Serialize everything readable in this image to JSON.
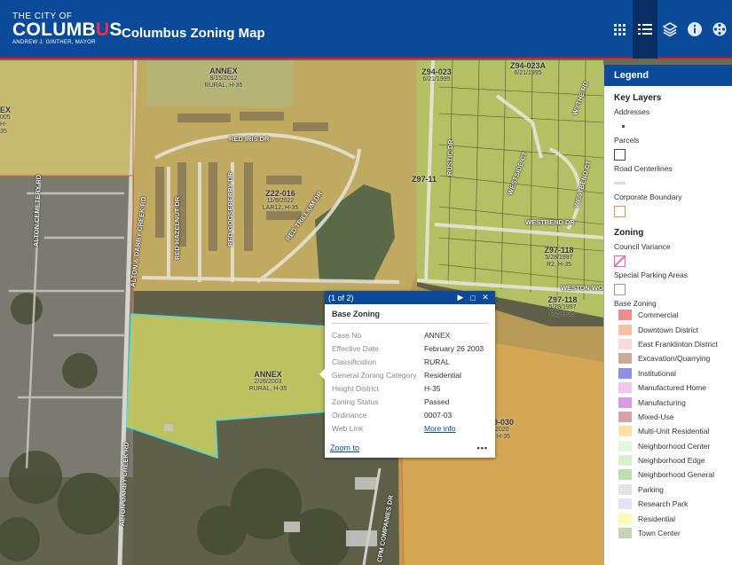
{
  "header": {
    "logo": {
      "line1": "THE CITY OF",
      "line2a": "COLUMB",
      "line2b": "U",
      "line2c": "S",
      "line3": "ANDREW J. GINTHER, MAYOR"
    },
    "title": "Columbus Zoning Map",
    "tools": [
      {
        "name": "basemap-gallery",
        "icon": "grid-icon"
      },
      {
        "name": "legend",
        "icon": "list-icon",
        "active": true
      },
      {
        "name": "layer-list",
        "icon": "layers-icon"
      },
      {
        "name": "about",
        "icon": "info-icon"
      },
      {
        "name": "basemap",
        "icon": "film-reel-icon"
      }
    ]
  },
  "map": {
    "zone_labels": [
      {
        "id": "annex-top",
        "name": "ANNEX",
        "date": "8/15/2012",
        "cls": "RURAL, H-35"
      },
      {
        "id": "z22-016",
        "name": "Z22-016",
        "date": "11/9/2022",
        "cls": "LAR12, H-35"
      },
      {
        "id": "annex-main",
        "name": "ANNEX",
        "date": "2/26/2003",
        "cls": "RURAL, H-35"
      },
      {
        "id": "z94-023",
        "name": "Z94-023",
        "date": "6/21/1995",
        "cls": ""
      },
      {
        "id": "z94-023a",
        "name": "Z94-023A",
        "date": "6/21/1995",
        "cls": ""
      },
      {
        "id": "z97-118a",
        "name": "Z97-118",
        "date": "5/28/1997",
        "cls": "R2, H-35"
      },
      {
        "id": "z97-118b",
        "name": "Z97-118",
        "date": "5/28/1997",
        "cls": "R2, H-35"
      },
      {
        "id": "z97-11x",
        "name": "Z97-11",
        "date": "",
        "cls": ""
      },
      {
        "id": "x-left",
        "name": "EX",
        "date": "005",
        "cls": "H-35"
      },
      {
        "id": "z19-030",
        "name": "9-030",
        "date": "/2020",
        "cls": ", H-35"
      }
    ],
    "roads": [
      "RED IRIS DR",
      "RED TRILLIUM DR",
      "RED HAZELNUT DR",
      "RED GOOSEBERRY DR",
      "ALTON & DARBY CREEK RD",
      "ALTON DARBY CREEK RD",
      "ALTON CEMETERY RD",
      "WESTBEND DR",
      "WESTON WO",
      "CPM COMPANIES DR",
      "RUSTIC DR",
      "WESTSIDE CT",
      "WYTHE RD",
      "WESTBEND CT"
    ]
  },
  "popup": {
    "pager": "(1 of 2)",
    "title": "Base Zoning",
    "rows": [
      {
        "key": "Case No",
        "value": "ANNEX"
      },
      {
        "key": "Effective Date",
        "value": "February 26 2003"
      },
      {
        "key": "Classification",
        "value": "RURAL"
      },
      {
        "key": "General Zoning Category",
        "value": "Residential"
      },
      {
        "key": "Height District",
        "value": "H-35"
      },
      {
        "key": "Zoning Status",
        "value": "Passed"
      },
      {
        "key": "Ordinance",
        "value": "0007-03"
      },
      {
        "key": "Web Link",
        "value": "More info"
      }
    ],
    "zoom_to": "Zoom to",
    "more": "•••"
  },
  "legend": {
    "title": "Legend",
    "key_layers_heading": "Key Layers",
    "key_layers": [
      "Addresses",
      "Parcels",
      "Road Centerlines",
      "Corporate Boundary"
    ],
    "zoning_heading": "Zoning",
    "council_variance": "Council Variance",
    "special_parking": "Special Parking Areas",
    "base_zoning": "Base Zoning",
    "zones": [
      {
        "label": "Commercial",
        "color": "#f28b8b"
      },
      {
        "label": "Downtown District",
        "color": "#f9c0a8"
      },
      {
        "label": "East Franklinton District",
        "color": "#fbdada"
      },
      {
        "label": "Excavation/Quarrying",
        "color": "#c8aa96"
      },
      {
        "label": "Institutional",
        "color": "#8f8fe8"
      },
      {
        "label": "Manufactured Home",
        "color": "#f3c6f0"
      },
      {
        "label": "Manufacturing",
        "color": "#d79be8"
      },
      {
        "label": "Mixed-Use",
        "color": "#d9a0a8"
      },
      {
        "label": "Multi-Unit Residential",
        "color": "#fde0a8"
      },
      {
        "label": "Neighborhood Center",
        "color": "#e6f6dc"
      },
      {
        "label": "Neighborhood Edge",
        "color": "#d6f0d0"
      },
      {
        "label": "Neighborhood General",
        "color": "#b8e0b0"
      },
      {
        "label": "Parking",
        "color": "#e4e4e4"
      },
      {
        "label": "Research Park",
        "color": "#e8e0fa"
      },
      {
        "label": "Residential",
        "color": "#fafab0"
      },
      {
        "label": "Town Center",
        "color": "#c4d4b4"
      }
    ]
  }
}
